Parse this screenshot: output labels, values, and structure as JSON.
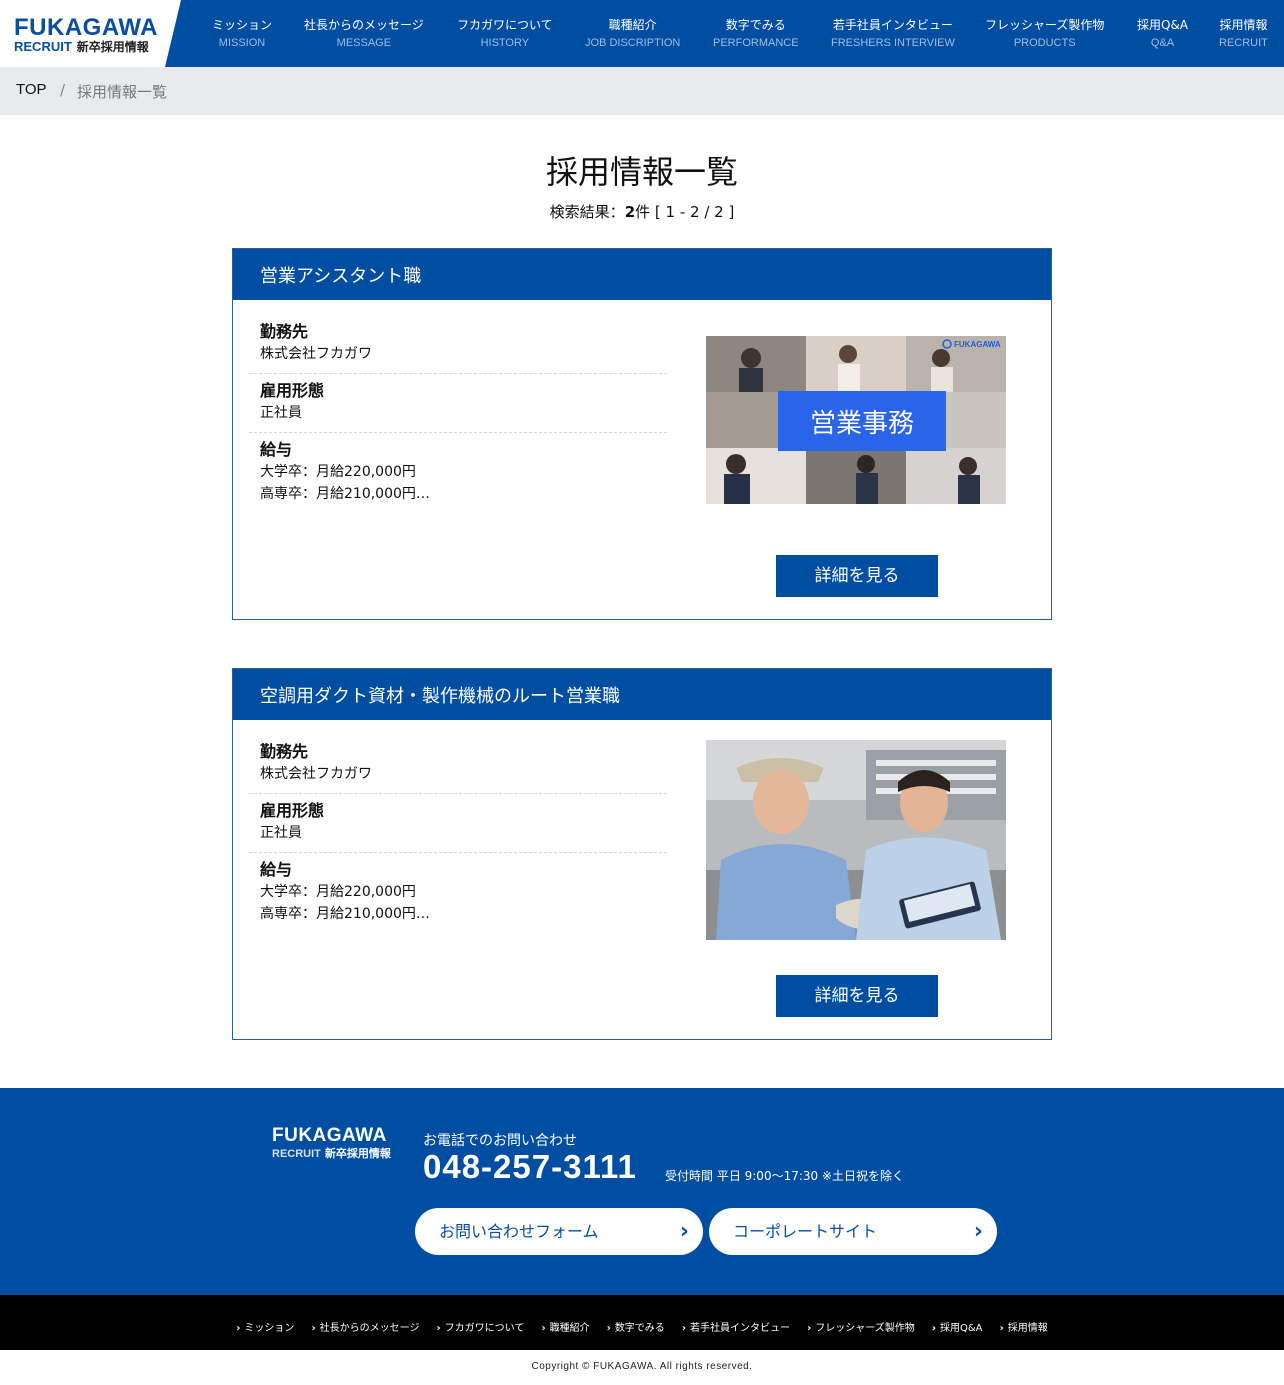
{
  "header": {
    "logo_main": "FUKAGAWA",
    "logo_en": "RECRUIT",
    "logo_jp": "新卒採用情報",
    "nav": [
      {
        "jp": "ミッション",
        "en": "MISSION"
      },
      {
        "jp": "社長からのメッセージ",
        "en": "MESSAGE"
      },
      {
        "jp": "フカガワについて",
        "en": "HISTORY"
      },
      {
        "jp": "職種紹介",
        "en": "JOB DISCRIPTION"
      },
      {
        "jp": "数字でみる",
        "en": "PERFORMANCE"
      },
      {
        "jp": "若手社員インタビュー",
        "en": "FRESHERS INTERVIEW"
      },
      {
        "jp": "フレッシャーズ製作物",
        "en": "PRODUCTS"
      },
      {
        "jp": "採用Q&A",
        "en": "Q&A"
      },
      {
        "jp": "採用情報",
        "en": "RECRUIT"
      }
    ]
  },
  "breadcrumb": {
    "top": "TOP",
    "sep": "/",
    "current": "採用情報一覧"
  },
  "page": {
    "title": "採用情報一覧",
    "result_prefix": "検索結果：",
    "result_count": "2",
    "result_suffix": "件 [ 1 - 2 / 2 ]"
  },
  "jobs": [
    {
      "title": "営業アシスタント職",
      "workplace_label": "勤務先",
      "workplace": "株式会社フカガワ",
      "employment_label": "雇用形態",
      "employment": "正社員",
      "salary_label": "給与",
      "salary_1": "大学卒：月給220,000円",
      "salary_2": "高専卒：月給210,000円…",
      "image_caption": "営業事務",
      "image_logo": "FUKAGAWA",
      "button": "詳細を見る"
    },
    {
      "title": "空調用ダクト資材・製作機械のルート営業職",
      "workplace_label": "勤務先",
      "workplace": "株式会社フカガワ",
      "employment_label": "雇用形態",
      "employment": "正社員",
      "salary_label": "給与",
      "salary_1": "大学卒：月給220,000円",
      "salary_2": "高専卒：月給210,000円…",
      "button": "詳細を見る"
    }
  ],
  "footer": {
    "logo_main": "FUKAGAWA",
    "logo_en": "RECRUIT",
    "logo_jp": "新卒採用情報",
    "contact_label": "お電話でのお問い合わせ",
    "phone": "048-257-3111",
    "hours": "受付時間 平日 9:00～17:30 ※土日祝を除く",
    "btn_form": "お問い合わせフォーム",
    "btn_corp": "コーポレートサイト"
  },
  "sub_nav": [
    "ミッション",
    "社長からのメッセージ",
    "フカガワについて",
    "職種紹介",
    "数字でみる",
    "若手社員インタビュー",
    "フレッシャーズ製作物",
    "採用Q&A",
    "採用情報"
  ],
  "copyright": "Copyright © FUKAGAWA. All rights reserved.",
  "colors": {
    "primary": "#004ea2",
    "breadcrumb_bg": "#e8ebee",
    "subnav_bg": "#000000"
  }
}
